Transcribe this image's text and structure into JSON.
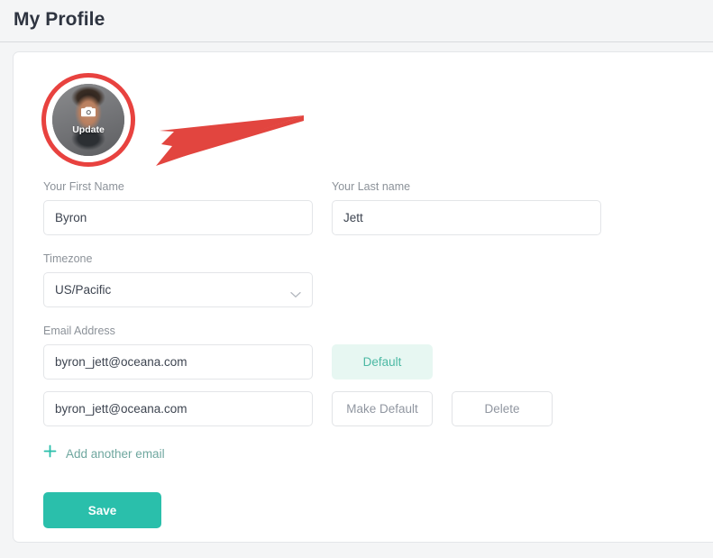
{
  "header": {
    "title": "My Profile"
  },
  "avatar": {
    "update_label": "Update",
    "camera_icon": "camera-icon",
    "annotation": {
      "ring_color": "#e8423f",
      "arrow_color": "#e2453f"
    }
  },
  "form": {
    "first_name": {
      "label": "Your First Name",
      "value": "Byron",
      "placeholder": ""
    },
    "last_name": {
      "label": "Your Last name",
      "value": "Jett",
      "placeholder": ""
    },
    "timezone": {
      "label": "Timezone",
      "value": "US/Pacific",
      "chevron_icon": "chevron-down-icon"
    },
    "email": {
      "label": "Email Address",
      "rows": [
        {
          "value": "byron_jett@oceana.com",
          "status_label": "Default",
          "is_default": true
        },
        {
          "value": "byron_jett@oceana.com",
          "make_default_label": "Make Default",
          "delete_label": "Delete",
          "is_default": false
        }
      ],
      "add_label": "Add another email",
      "add_icon": "plus-icon"
    }
  },
  "actions": {
    "save_label": "Save"
  },
  "colors": {
    "page_bg": "#f4f5f6",
    "card_bg": "#ffffff",
    "accent_teal": "#2abfab",
    "badge_bg": "#e7f7f2",
    "badge_text": "#4cb9a4",
    "label_gray": "#8c9299",
    "title_navy": "#2e3440",
    "annotation_red": "#e8423f"
  }
}
